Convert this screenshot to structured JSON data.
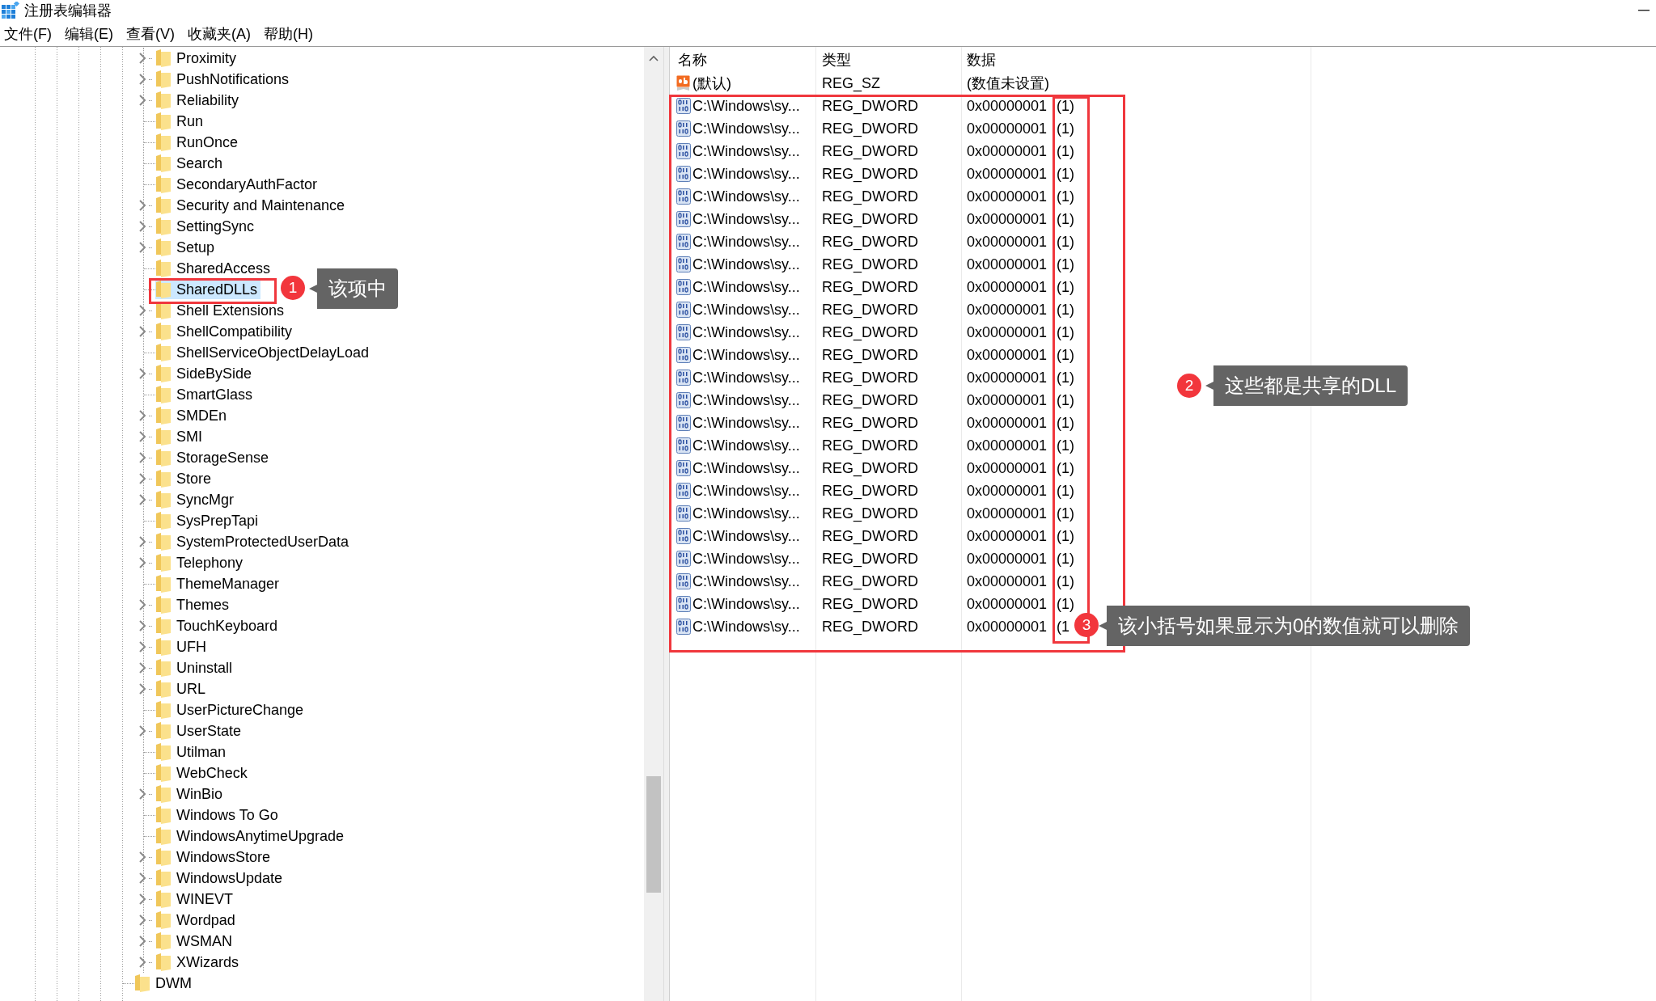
{
  "window": {
    "title": "注册表编辑器"
  },
  "menu": [
    "文件(F)",
    "编辑(E)",
    "查看(V)",
    "收藏夹(A)",
    "帮助(H)"
  ],
  "tree": {
    "items": [
      {
        "children": [
          {
            "label": "Proximity",
            "expandable": true,
            "selected": false
          },
          {
            "label": "PushNotifications",
            "expandable": true,
            "selected": false
          },
          {
            "label": "Reliability",
            "expandable": true,
            "selected": false
          },
          {
            "label": "Run",
            "expandable": false,
            "selected": false
          },
          {
            "label": "RunOnce",
            "expandable": false,
            "selected": false
          },
          {
            "label": "Search",
            "expandable": false,
            "selected": false
          },
          {
            "label": "SecondaryAuthFactor",
            "expandable": false,
            "selected": false
          },
          {
            "label": "Security and Maintenance",
            "expandable": true,
            "selected": false
          },
          {
            "label": "SettingSync",
            "expandable": true,
            "selected": false
          },
          {
            "label": "Setup",
            "expandable": true,
            "selected": false
          },
          {
            "label": "SharedAccess",
            "expandable": false,
            "selected": false
          },
          {
            "label": "SharedDLLs",
            "expandable": false,
            "selected": true
          },
          {
            "label": "Shell Extensions",
            "expandable": true,
            "selected": false
          },
          {
            "label": "ShellCompatibility",
            "expandable": true,
            "selected": false
          },
          {
            "label": "ShellServiceObjectDelayLoad",
            "expandable": false,
            "selected": false
          },
          {
            "label": "SideBySide",
            "expandable": true,
            "selected": false
          },
          {
            "label": "SmartGlass",
            "expandable": false,
            "selected": false
          },
          {
            "label": "SMDEn",
            "expandable": true,
            "selected": false
          },
          {
            "label": "SMI",
            "expandable": true,
            "selected": false
          },
          {
            "label": "StorageSense",
            "expandable": true,
            "selected": false
          },
          {
            "label": "Store",
            "expandable": true,
            "selected": false
          },
          {
            "label": "SyncMgr",
            "expandable": true,
            "selected": false
          },
          {
            "label": "SysPrepTapi",
            "expandable": false,
            "selected": false
          },
          {
            "label": "SystemProtectedUserData",
            "expandable": true,
            "selected": false
          },
          {
            "label": "Telephony",
            "expandable": true,
            "selected": false
          },
          {
            "label": "ThemeManager",
            "expandable": false,
            "selected": false
          },
          {
            "label": "Themes",
            "expandable": true,
            "selected": false
          },
          {
            "label": "TouchKeyboard",
            "expandable": true,
            "selected": false
          },
          {
            "label": "UFH",
            "expandable": true,
            "selected": false
          },
          {
            "label": "Uninstall",
            "expandable": true,
            "selected": false
          },
          {
            "label": "URL",
            "expandable": true,
            "selected": false
          },
          {
            "label": "UserPictureChange",
            "expandable": false,
            "selected": false
          },
          {
            "label": "UserState",
            "expandable": true,
            "selected": false
          },
          {
            "label": "Utilman",
            "expandable": false,
            "selected": false
          },
          {
            "label": "WebCheck",
            "expandable": false,
            "selected": false
          },
          {
            "label": "WinBio",
            "expandable": true,
            "selected": false
          },
          {
            "label": "Windows To Go",
            "expandable": false,
            "selected": false
          },
          {
            "label": "WindowsAnytimeUpgrade",
            "expandable": false,
            "selected": false
          },
          {
            "label": "WindowsStore",
            "expandable": true,
            "selected": false
          },
          {
            "label": "WindowsUpdate",
            "expandable": true,
            "selected": false
          },
          {
            "label": "WINEVT",
            "expandable": true,
            "selected": false
          },
          {
            "label": "Wordpad",
            "expandable": true,
            "selected": false
          },
          {
            "label": "WSMAN",
            "expandable": true,
            "selected": false
          },
          {
            "label": "XWizards",
            "expandable": true,
            "selected": false
          }
        ]
      },
      {
        "label": "DWM",
        "expandable": false,
        "selected": false
      }
    ]
  },
  "values": {
    "columns": [
      "名称",
      "类型",
      "数据"
    ],
    "rows": [
      {
        "kind": "string",
        "name": "(默认)",
        "type": "REG_SZ",
        "data": "(数值未设置)"
      },
      {
        "kind": "dword",
        "name": "C:\\Windows\\sy...",
        "type": "REG_DWORD",
        "data": "0x00000001 (1)"
      },
      {
        "kind": "dword",
        "name": "C:\\Windows\\sy...",
        "type": "REG_DWORD",
        "data": "0x00000001 (1)"
      },
      {
        "kind": "dword",
        "name": "C:\\Windows\\sy...",
        "type": "REG_DWORD",
        "data": "0x00000001 (1)"
      },
      {
        "kind": "dword",
        "name": "C:\\Windows\\sy...",
        "type": "REG_DWORD",
        "data": "0x00000001 (1)"
      },
      {
        "kind": "dword",
        "name": "C:\\Windows\\sy...",
        "type": "REG_DWORD",
        "data": "0x00000001 (1)"
      },
      {
        "kind": "dword",
        "name": "C:\\Windows\\sy...",
        "type": "REG_DWORD",
        "data": "0x00000001 (1)"
      },
      {
        "kind": "dword",
        "name": "C:\\Windows\\sy...",
        "type": "REG_DWORD",
        "data": "0x00000001 (1)"
      },
      {
        "kind": "dword",
        "name": "C:\\Windows\\sy...",
        "type": "REG_DWORD",
        "data": "0x00000001 (1)"
      },
      {
        "kind": "dword",
        "name": "C:\\Windows\\sy...",
        "type": "REG_DWORD",
        "data": "0x00000001 (1)"
      },
      {
        "kind": "dword",
        "name": "C:\\Windows\\sy...",
        "type": "REG_DWORD",
        "data": "0x00000001 (1)"
      },
      {
        "kind": "dword",
        "name": "C:\\Windows\\sy...",
        "type": "REG_DWORD",
        "data": "0x00000001 (1)"
      },
      {
        "kind": "dword",
        "name": "C:\\Windows\\sy...",
        "type": "REG_DWORD",
        "data": "0x00000001 (1)"
      },
      {
        "kind": "dword",
        "name": "C:\\Windows\\sy...",
        "type": "REG_DWORD",
        "data": "0x00000001 (1)"
      },
      {
        "kind": "dword",
        "name": "C:\\Windows\\sy...",
        "type": "REG_DWORD",
        "data": "0x00000001 (1)"
      },
      {
        "kind": "dword",
        "name": "C:\\Windows\\sy...",
        "type": "REG_DWORD",
        "data": "0x00000001 (1)"
      },
      {
        "kind": "dword",
        "name": "C:\\Windows\\sy...",
        "type": "REG_DWORD",
        "data": "0x00000001 (1)"
      },
      {
        "kind": "dword",
        "name": "C:\\Windows\\sy...",
        "type": "REG_DWORD",
        "data": "0x00000001 (1)"
      },
      {
        "kind": "dword",
        "name": "C:\\Windows\\sy...",
        "type": "REG_DWORD",
        "data": "0x00000001 (1)"
      },
      {
        "kind": "dword",
        "name": "C:\\Windows\\sy...",
        "type": "REG_DWORD",
        "data": "0x00000001 (1)"
      },
      {
        "kind": "dword",
        "name": "C:\\Windows\\sy...",
        "type": "REG_DWORD",
        "data": "0x00000001 (1)"
      },
      {
        "kind": "dword",
        "name": "C:\\Windows\\sy...",
        "type": "REG_DWORD",
        "data": "0x00000001 (1)"
      },
      {
        "kind": "dword",
        "name": "C:\\Windows\\sy...",
        "type": "REG_DWORD",
        "data": "0x00000001 (1)"
      },
      {
        "kind": "dword",
        "name": "C:\\Windows\\sy...",
        "type": "REG_DWORD",
        "data": "0x00000001 (1)"
      },
      {
        "kind": "dword",
        "name": "C:\\Windows\\sy...",
        "type": "REG_DWORD",
        "data": "0x00000001 (1"
      }
    ]
  },
  "annotations": [
    {
      "number": "1",
      "text": "该项中"
    },
    {
      "number": "2",
      "text": "这些都是共享的DLL"
    },
    {
      "number": "3",
      "text": "该小括号如果显示为0的数值就可以删除"
    }
  ]
}
